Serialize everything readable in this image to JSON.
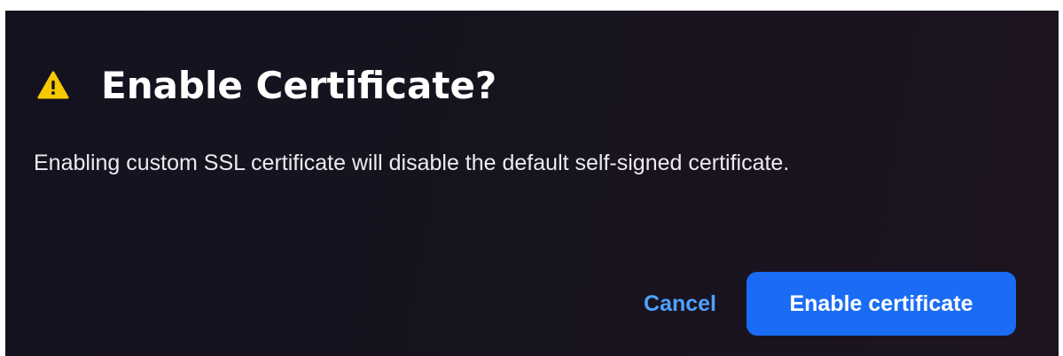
{
  "dialog": {
    "title": "Enable Certificate?",
    "icon": "warning-triangle-icon",
    "message": "Enabling custom SSL certificate will disable the default self-signed certificate.",
    "cancel_label": "Cancel",
    "confirm_label": "Enable certificate"
  },
  "colors": {
    "background": "#17131f",
    "warning": "#f6c800",
    "link": "#4ea1ff",
    "primary": "#1a6cf5"
  }
}
